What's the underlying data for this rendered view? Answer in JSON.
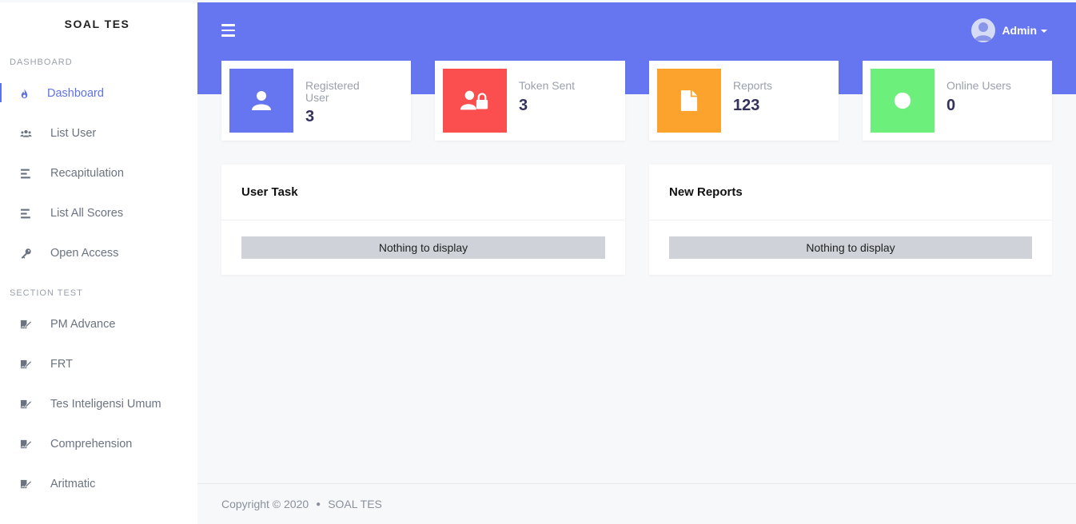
{
  "brand": "SOAL TES",
  "sidebar": {
    "sections": [
      {
        "title": "DASHBOARD"
      },
      {
        "title": "SECTION TEST"
      }
    ],
    "items": [
      {
        "label": "Dashboard",
        "icon": "flame-icon"
      },
      {
        "label": "List User",
        "icon": "users-icon"
      },
      {
        "label": "Recapitulation",
        "icon": "align-left-icon"
      },
      {
        "label": "List All Scores",
        "icon": "align-left-icon"
      },
      {
        "label": "Open Access",
        "icon": "key-icon"
      },
      {
        "label": "PM Advance",
        "icon": "signature-icon"
      },
      {
        "label": "FRT",
        "icon": "signature-icon"
      },
      {
        "label": "Tes Inteligensi Umum",
        "icon": "signature-icon"
      },
      {
        "label": "Comprehension",
        "icon": "signature-icon"
      },
      {
        "label": "Aritmatic",
        "icon": "signature-icon"
      }
    ]
  },
  "topbar": {
    "user": "Admin"
  },
  "stats": [
    {
      "label": "Registered User",
      "value": "3",
      "color": "#6676f0",
      "icon": "user-icon"
    },
    {
      "label": "Token Sent",
      "value": "3",
      "color": "#fb4f4f",
      "icon": "user-lock-icon"
    },
    {
      "label": "Reports",
      "value": "123",
      "color": "#fba32c",
      "icon": "file-icon"
    },
    {
      "label": "Online Users",
      "value": "0",
      "color": "#6cf07b",
      "icon": "circle-icon"
    }
  ],
  "panels": [
    {
      "title": "User Task",
      "empty": "Nothing to display"
    },
    {
      "title": "New Reports",
      "empty": "Nothing to display"
    }
  ],
  "footer": {
    "copyright": "Copyright © 2020",
    "brand": "SOAL TES"
  },
  "colors": {
    "accent": "#5e72e4",
    "topbar": "#6676f0"
  }
}
